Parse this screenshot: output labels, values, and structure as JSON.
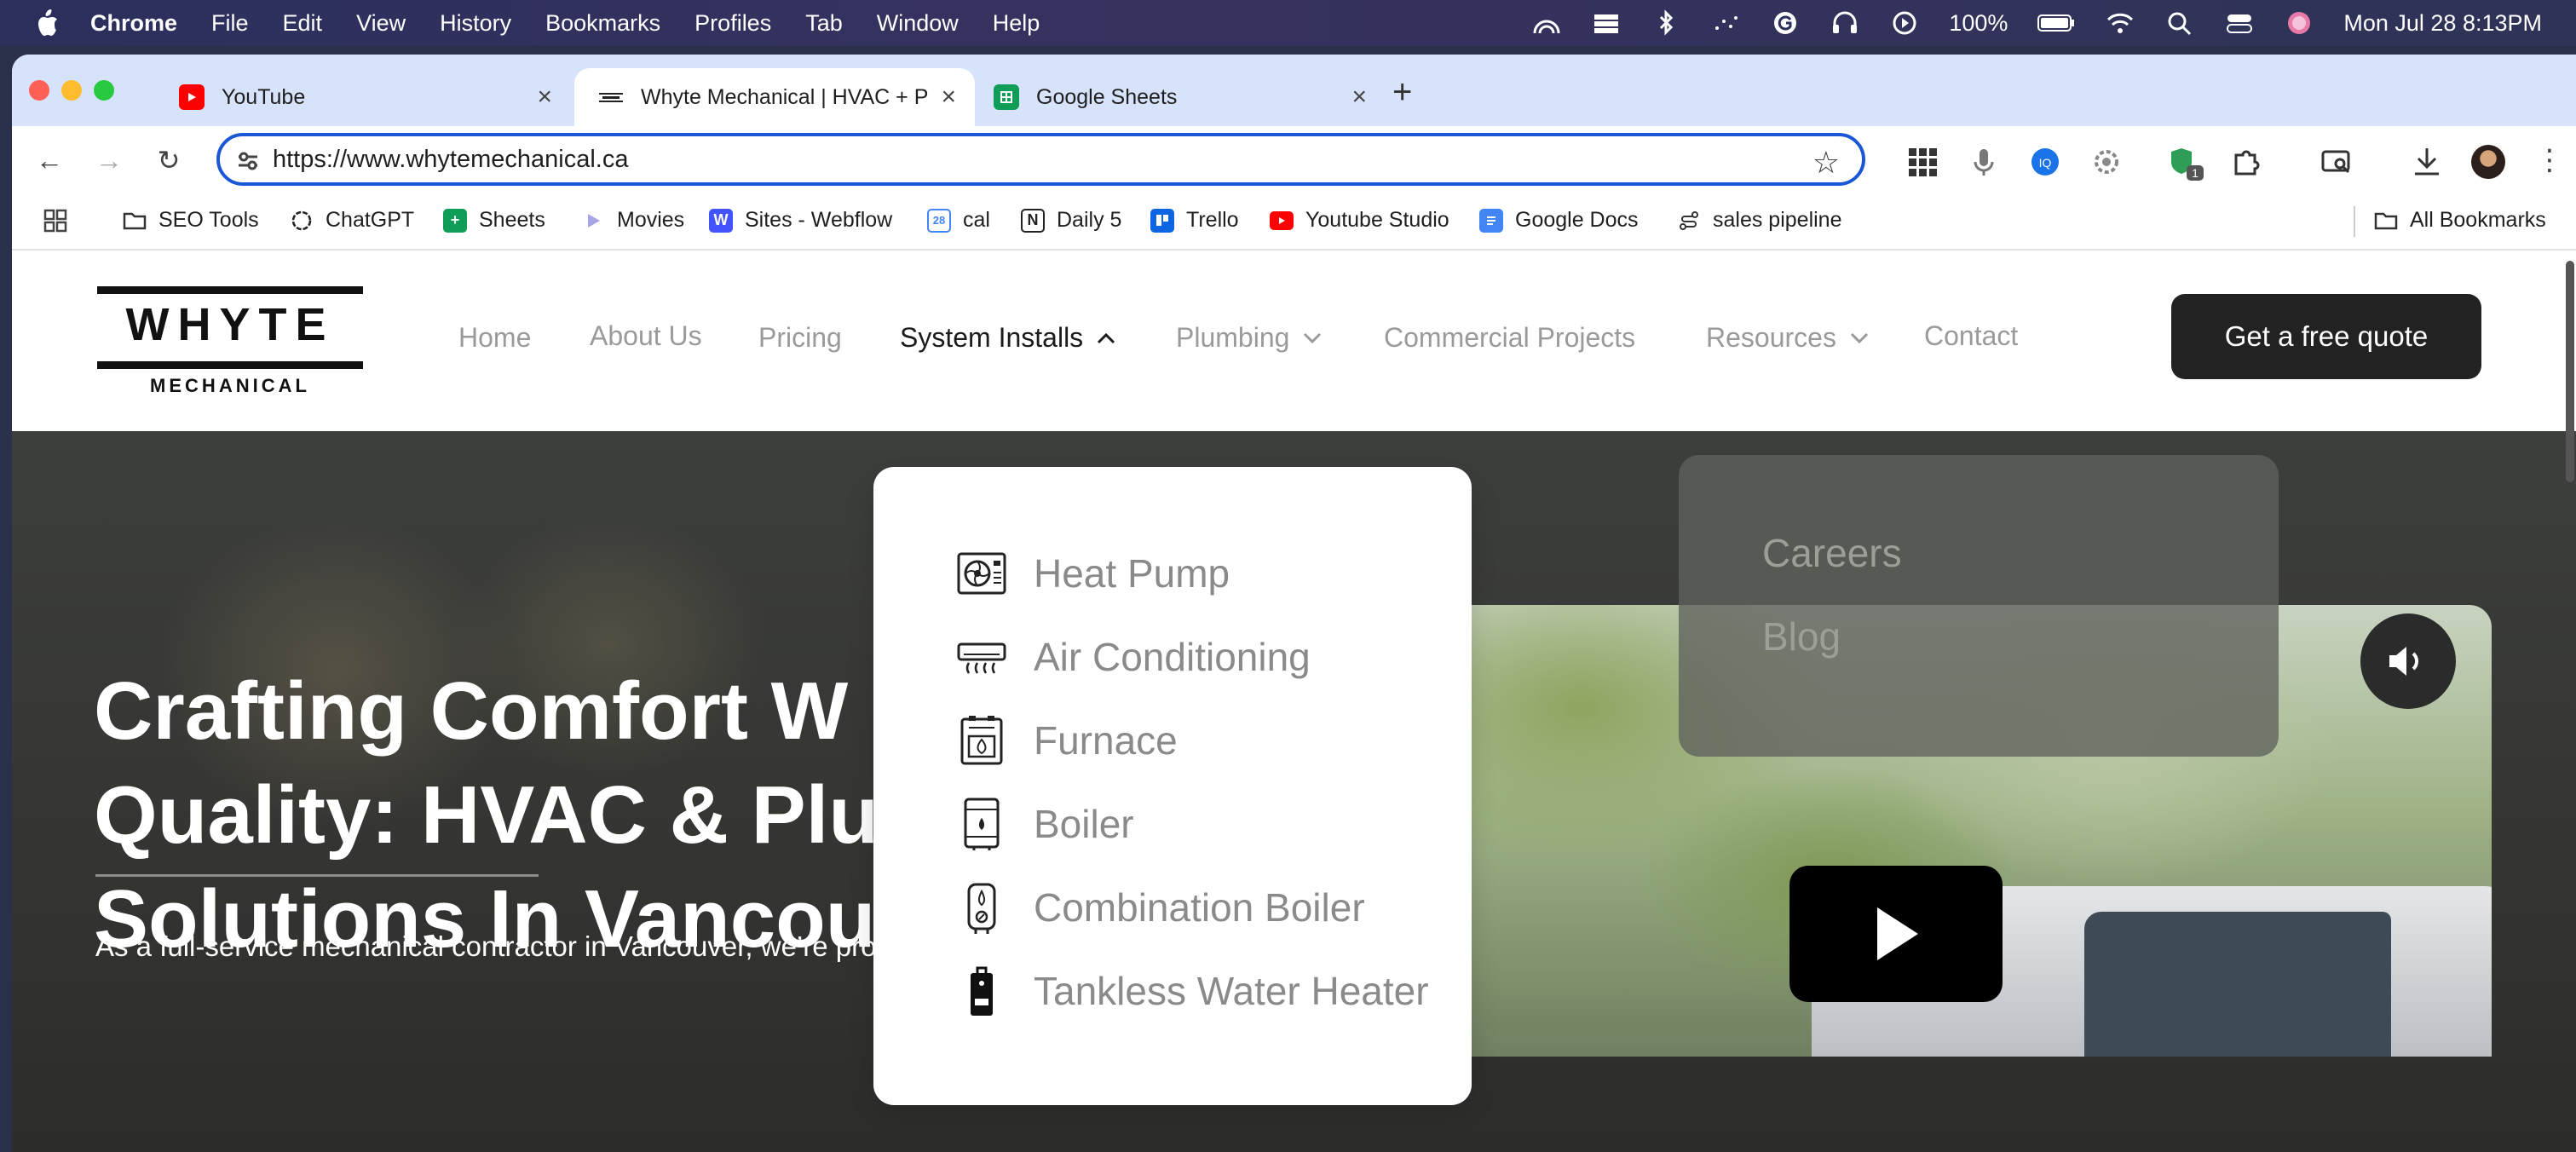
{
  "menubar": {
    "app": "Chrome",
    "items": [
      "File",
      "Edit",
      "View",
      "History",
      "Bookmarks",
      "Profiles",
      "Tab",
      "Window",
      "Help"
    ],
    "battery": "100%",
    "datetime": "Mon Jul 28  8:13PM"
  },
  "tabs": [
    {
      "title": "YouTube",
      "favicon": "youtube-icon"
    },
    {
      "title": "Whyte Mechanical | HVAC + P",
      "favicon": "whyte-favicon"
    },
    {
      "title": "Google Sheets",
      "favicon": "sheets-icon"
    }
  ],
  "omnibox": {
    "url": "https://www.whytemechanical.ca"
  },
  "extensions": {
    "badge": "1"
  },
  "bookmarks": [
    {
      "label": "SEO Tools",
      "icon": "folder-icon"
    },
    {
      "label": "ChatGPT",
      "icon": "chatgpt-icon"
    },
    {
      "label": "Sheets",
      "icon": "sheets-icon"
    },
    {
      "label": "Movies",
      "icon": "movies-icon"
    },
    {
      "label": "Sites - Webflow",
      "icon": "webflow-icon"
    },
    {
      "label": "cal",
      "icon": "calendar-icon"
    },
    {
      "label": "Daily 5",
      "icon": "notion-icon"
    },
    {
      "label": "Trello",
      "icon": "trello-icon"
    },
    {
      "label": "Youtube Studio",
      "icon": "youtube-icon"
    },
    {
      "label": "Google Docs",
      "icon": "docs-icon"
    },
    {
      "label": "sales pipeline",
      "icon": "pipeline-icon"
    }
  ],
  "all_bookmarks": "All Bookmarks",
  "site": {
    "logo": {
      "word": "WHYTE",
      "sub": "MECHANICAL"
    },
    "nav": [
      "Home",
      "About Us",
      "Pricing",
      "System Installs",
      "Plumbing",
      "Commercial Projects",
      "Resources",
      "Contact"
    ],
    "cta": "Get a free quote",
    "hero": {
      "line1": "Crafting Comfort W",
      "line2": "Quality: HVAC & Plur",
      "line3": "Solutions In Vancou",
      "text": "As a full-service mechanical contractor in Vancouver, we’re proud to"
    },
    "system_installs_menu": [
      {
        "label": "Heat Pump",
        "icon": "heat-pump-icon"
      },
      {
        "label": "Air Conditioning",
        "icon": "air-conditioning-icon"
      },
      {
        "label": "Furnace",
        "icon": "furnace-icon"
      },
      {
        "label": "Boiler",
        "icon": "boiler-icon"
      },
      {
        "label": "Combination Boiler",
        "icon": "combination-boiler-icon"
      },
      {
        "label": "Tankless Water Heater",
        "icon": "tankless-water-heater-icon"
      }
    ],
    "resources_menu": [
      "Careers",
      "Blog"
    ]
  }
}
